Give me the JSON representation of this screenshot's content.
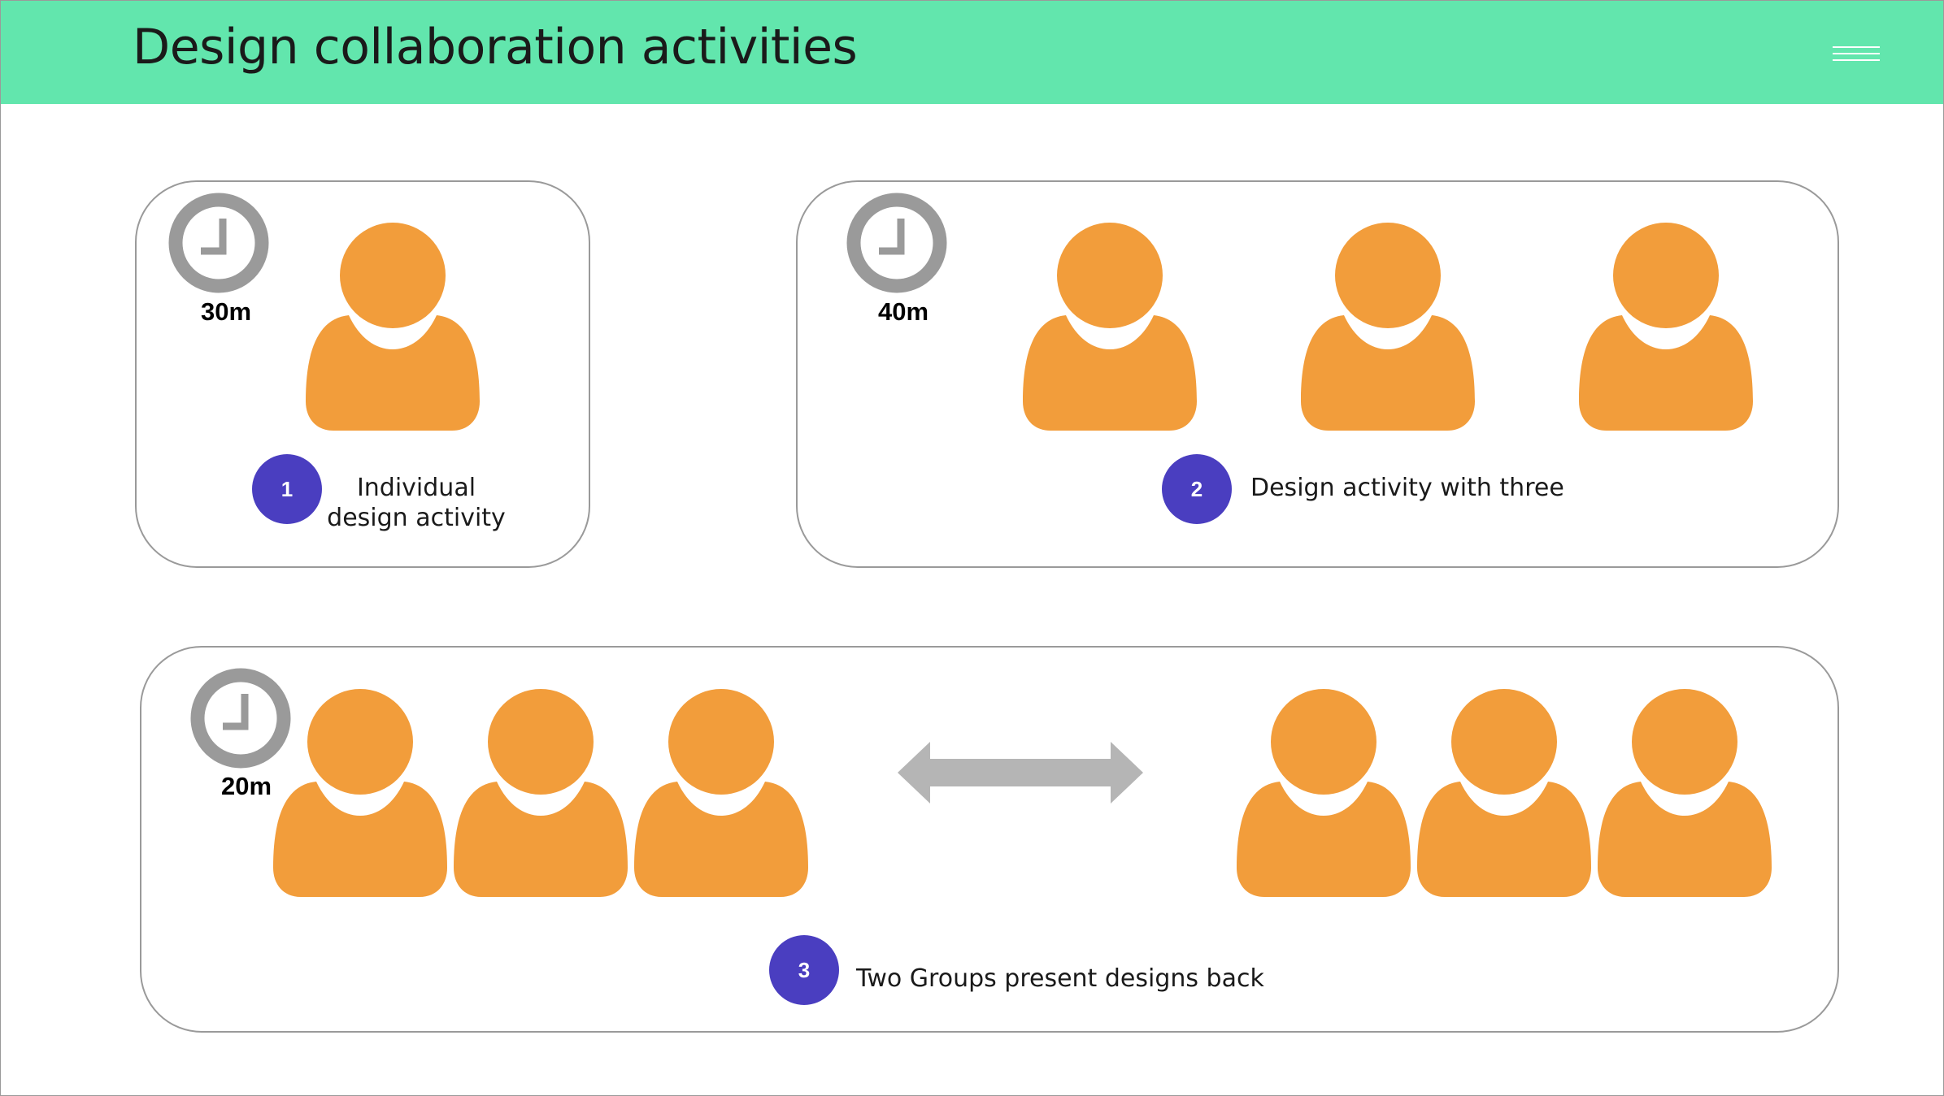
{
  "header": {
    "title": "Design collaboration activities",
    "menu_icon": "hamburger-menu-icon"
  },
  "colors": {
    "header_bg": "#62e6ad",
    "person": "#f29d3b",
    "badge": "#4a3ec0",
    "clock": "#9a9a9a",
    "arrow": "#b5b5b5",
    "panel_border": "#9a9a9a"
  },
  "activities": [
    {
      "number": "1",
      "duration": "30m",
      "caption_lines": [
        "Individual",
        "design activity"
      ],
      "people": 1,
      "clock_icon": "clock-icon",
      "person_icon": "person-icon"
    },
    {
      "number": "2",
      "duration": "40m",
      "caption": "Design activity with three",
      "people": 3,
      "clock_icon": "clock-icon",
      "person_icon": "person-icon"
    },
    {
      "number": "3",
      "duration": "20m",
      "caption": "Two Groups present designs back",
      "people": 6,
      "groups": 2,
      "clock_icon": "clock-icon",
      "person_icon": "person-icon",
      "connector_icon": "double-arrow-icon"
    }
  ]
}
